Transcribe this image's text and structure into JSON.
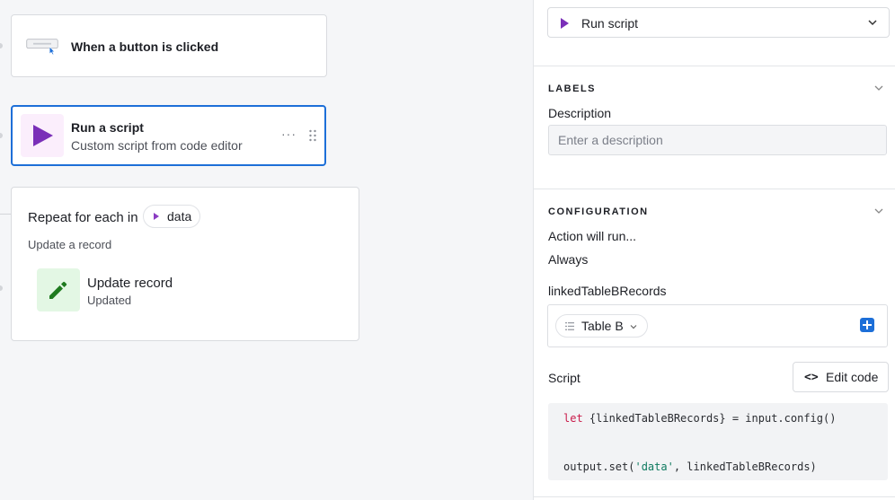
{
  "canvas": {
    "trigger": {
      "title": "When a button is clicked"
    },
    "run_script": {
      "title": "Run a script",
      "subtitle": "Custom script from code editor",
      "more": "···"
    },
    "repeat": {
      "title": "Repeat for each in",
      "chip_label": "data",
      "subtitle": "Update a record",
      "action": {
        "title": "Update record",
        "subtitle": "Updated"
      }
    }
  },
  "panel": {
    "action_select": {
      "label": "Run script"
    },
    "labels_section": {
      "title": "LABELS",
      "description_label": "Description",
      "description_placeholder": "Enter a description"
    },
    "config_section": {
      "title": "CONFIGURATION",
      "run_condition_label": "Action will run...",
      "run_condition_value": "Always",
      "input_name": "linkedTableBRecords",
      "input_value": "Table B",
      "script_label": "Script",
      "edit_code_label": "Edit code",
      "code": {
        "line1_kw": "let",
        "line1_rest": " {linkedTableBRecords} = input.config()",
        "line2_a": "output.set(",
        "line2_str": "'data'",
        "line2_b": ", linkedTableBRecords)"
      }
    }
  },
  "colors": {
    "accent_blue": "#1d6fd8",
    "script_purple": "#7a2fb8",
    "update_green": "#1f7a1f"
  }
}
